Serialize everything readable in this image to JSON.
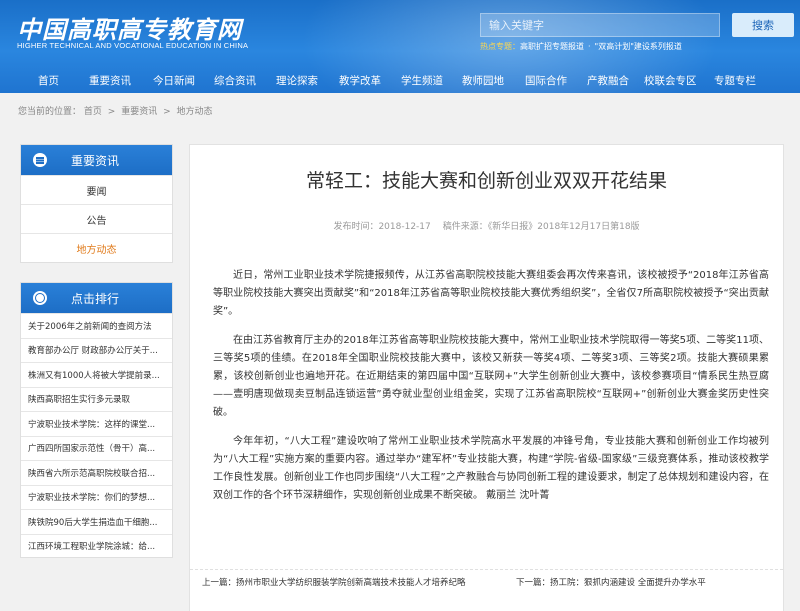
{
  "header": {
    "logo_cn": "中国高职高专教育网",
    "logo_en": "HIGHER TECHNICAL AND VOCATIONAL EDUCATION IN CHINA",
    "search_placeholder": "输入关键字",
    "search_button": "搜索",
    "hot_label": "热点专题：",
    "hot_links": [
      "高职扩招专题报道",
      "\"双高计划\"建设系列报道"
    ]
  },
  "nav": {
    "items": [
      "首页",
      "重要资讯",
      "今日新闻",
      "综合资讯",
      "理论探索",
      "教学改革",
      "学生频道",
      "教师园地",
      "国际合作",
      "产教融合",
      "校联会专区",
      "专题专栏"
    ]
  },
  "breadcrumb": {
    "prefix": "您当前的位置：",
    "items": [
      "首页",
      "重要资讯",
      "地方动态"
    ],
    "separator": ">"
  },
  "sidebar": {
    "news_title": "重要资讯",
    "news_items": [
      "要闻",
      "公告",
      "地方动态"
    ],
    "active_index": 2,
    "rank_title": "点击排行",
    "rank_items": [
      "关于2006年之前新闻的查阅方法",
      "教育部办公厅 财政部办公厅关于...",
      "株洲又有1000人将被大学提前录...",
      "陕西高职招生实行多元录取",
      "宁波职业技术学院：这样的课堂...",
      "广西四所国家示范性（骨干）高...",
      "陕西省六所示范高职院校联合招...",
      "宁波职业技术学院：你们的梦想...",
      "陕铁院90后大学生捐造血干细胞...",
      "江西环境工程职业学院涂城：给..."
    ]
  },
  "article": {
    "title": "常轻工：技能大赛和创新创业双双开花结果",
    "date_label": "发布时间：",
    "date": "2018-12-17",
    "source_label": "稿件来源：",
    "source": "《新华日报》2018年12月17日第18版",
    "paragraphs": [
      "近日，常州工业职业技术学院捷报频传，从江苏省高职院校技能大赛组委会再次传来喜讯，该校被授予“2018年江苏省高等职业院校技能大赛突出贡献奖”和“2018年江苏省高等职业院校技能大赛优秀组织奖”，全省仅7所高职院校被授予“突出贡献奖”。",
      "在由江苏省教育厅主办的2018年江苏省高等职业院校技能大赛中，常州工业职业技术学院取得一等奖5项、二等奖11项、三等奖5项的佳绩。在2018年全国职业院校技能大赛中，该校又新获一等奖4项、二等奖3项、三等奖2项。技能大赛硕果累累，该校创新创业也遍地开花。在近期结束的第四届中国“互联网+”大学生创新创业大赛中，该校参赛项目“情系民生热豆腐——壹明唐现做现卖豆制品连锁运营”勇夺就业型创业组金奖，实现了江苏省高职院校“互联网+”创新创业大赛金奖历史性突破。",
      "今年年初，“八大工程”建设吹响了常州工业职业技术学院高水平发展的冲锋号角，专业技能大赛和创新创业工作均被列为“八大工程”实施方案的重要内容。通过举办“建军杯”专业技能大赛，构建“学院-省级-国家级”三级竞赛体系，推动该校教学工作良性发展。创新创业工作也同步围绕“八大工程”之产教融合与协同创新工程的建设要求，制定了总体规划和建设内容，在双创工作的各个环节深耕细作，实现创新创业成果不断突破。 戴丽兰 沈叶菁"
    ],
    "prev_label": "上一篇：",
    "prev": "扬州市职业大学纺织服装学院创新高端技术技能人才培养纪略",
    "next_label": "下一篇：",
    "next": "扬工院：狠抓内涵建设 全面提升办学水平"
  }
}
